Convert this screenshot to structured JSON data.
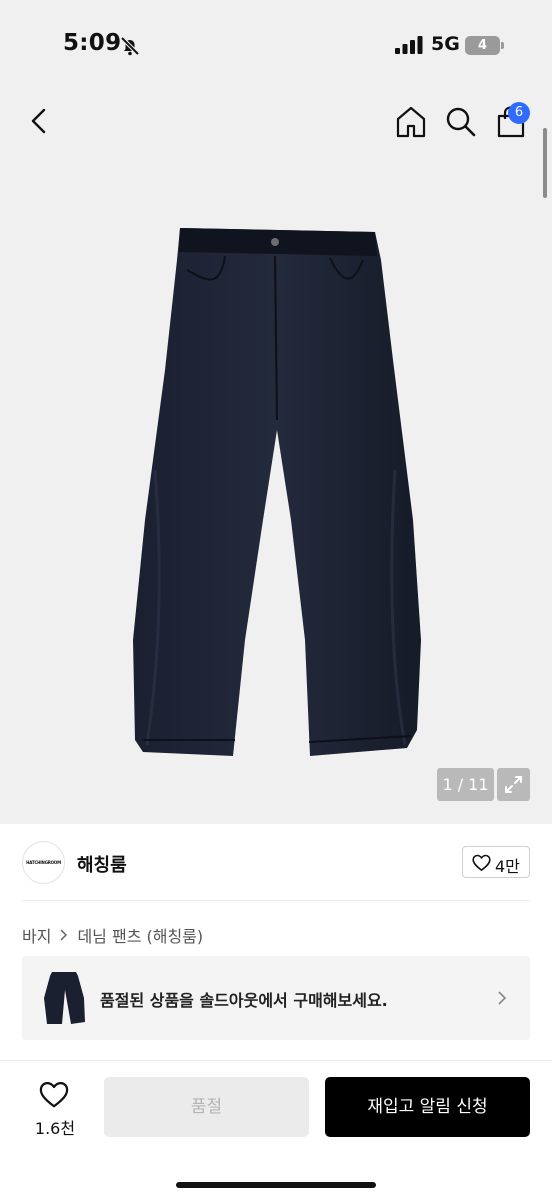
{
  "status_bar": {
    "time": "5:09",
    "network": "5G",
    "battery": "4"
  },
  "header": {
    "cart_count": "6"
  },
  "gallery": {
    "counter": "1 / 11",
    "background_color": "#f0f0f0"
  },
  "brand": {
    "logo_text": "HATCHINGROOM",
    "name": "해칭룸",
    "like_count": "4만"
  },
  "breadcrumb": {
    "items": [
      "바지",
      "데님 팬츠 (해칭룸)"
    ]
  },
  "soldout_banner": {
    "text": "품절된 상품을 솔드아웃에서 구매해보세요."
  },
  "bottom_bar": {
    "wish_count": "1.6천",
    "soldout_label": "품절",
    "restock_label": "재입고 알림 신청"
  },
  "colors": {
    "accent_badge": "#2f6bff",
    "primary_button": "#000000",
    "disabled_button": "#ebebeb"
  },
  "icons": [
    "bell-slash-icon",
    "signal-icon",
    "battery-icon",
    "back-icon",
    "home-icon",
    "search-icon",
    "shopping-bag-icon",
    "expand-icon",
    "heart-icon",
    "chevron-right-icon"
  ]
}
